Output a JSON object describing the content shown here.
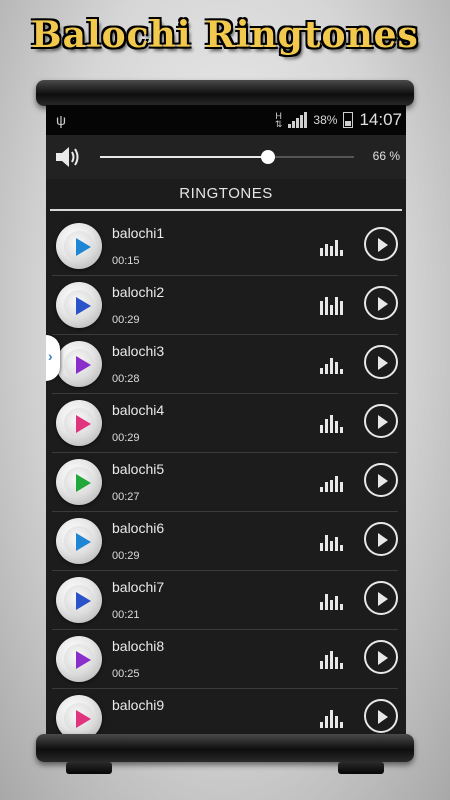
{
  "banner": {
    "title": "Balochi Ringtones"
  },
  "status_bar": {
    "network_label": "H",
    "battery": "38%",
    "time": "14:07"
  },
  "volume": {
    "value_label": "66 %",
    "level": 0.66
  },
  "section": {
    "title": "RINGTONES"
  },
  "ringtones": [
    {
      "title": "balochi1",
      "duration": "00:15",
      "disc_color": "#1f86d6",
      "bars": [
        8,
        12,
        10,
        16,
        6
      ]
    },
    {
      "title": "balochi2",
      "duration": "00:29",
      "disc_color": "#2a52c9",
      "bars": [
        14,
        18,
        10,
        18,
        14
      ]
    },
    {
      "title": "balochi3",
      "duration": "00:28",
      "disc_color": "#8a2fc9",
      "bars": [
        6,
        10,
        16,
        12,
        5
      ]
    },
    {
      "title": "balochi4",
      "duration": "00:29",
      "disc_color": "#e0357e",
      "bars": [
        8,
        14,
        18,
        12,
        6
      ]
    },
    {
      "title": "balochi5",
      "duration": "00:27",
      "disc_color": "#22a83a",
      "bars": [
        5,
        10,
        12,
        16,
        10
      ]
    },
    {
      "title": "balochi6",
      "duration": "00:29",
      "disc_color": "#1f86d6",
      "bars": [
        8,
        16,
        10,
        14,
        6
      ]
    },
    {
      "title": "balochi7",
      "duration": "00:21",
      "disc_color": "#2a52c9",
      "bars": [
        8,
        16,
        10,
        14,
        6
      ]
    },
    {
      "title": "balochi8",
      "duration": "00:25",
      "disc_color": "#8a2fc9",
      "bars": [
        8,
        14,
        18,
        12,
        6
      ]
    },
    {
      "title": "balochi9",
      "duration": "",
      "disc_color": "#e0357e",
      "bars": [
        6,
        12,
        18,
        12,
        6
      ]
    }
  ],
  "icons": {
    "usb": "usb-icon",
    "signal": "signal-icon",
    "battery": "battery-icon",
    "speaker": "speaker-icon",
    "play": "play-icon",
    "equalizer": "equalizer-icon",
    "drawer": "chevron-right-icon"
  }
}
